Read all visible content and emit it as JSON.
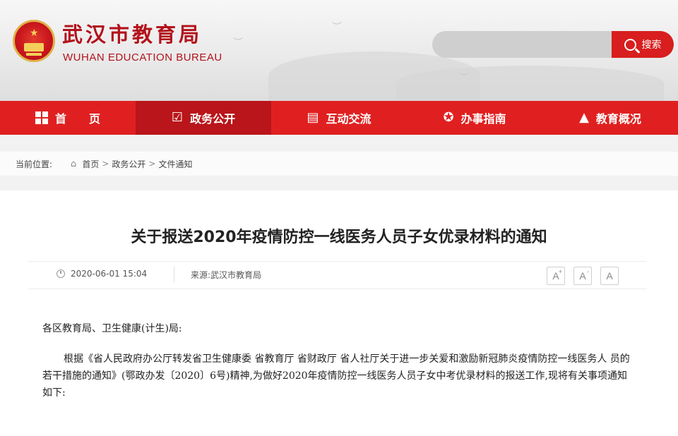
{
  "header": {
    "title": "武汉市教育局",
    "subtitle": "WUHAN EDUCATION BUREAU",
    "search": {
      "placeholder": "",
      "button_label": "搜索"
    }
  },
  "nav": {
    "items": [
      {
        "label": "首　　页",
        "icon": "home-grid-icon"
      },
      {
        "label": "政务公开",
        "icon": "calendar-check-icon"
      },
      {
        "label": "互动交流",
        "icon": "document-icon"
      },
      {
        "label": "办事指南",
        "icon": "star-badge-icon"
      },
      {
        "label": "教育概况",
        "icon": "graduation-cap-icon"
      }
    ],
    "active_index": 1
  },
  "breadcrumb": {
    "label": "当前位置:",
    "items": [
      "首页",
      "政务公开",
      "文件通知"
    ],
    "separator": ">"
  },
  "article": {
    "title": "关于报送2020年疫情防控一线医务人员子女优录材料的通知",
    "datetime": "2020-06-01 15:04",
    "source": "来源:武汉市教育局",
    "font_buttons": [
      "A+",
      "A-",
      "A"
    ],
    "salutation": "各区教育局、卫生健康(计生)局:",
    "paragraph": "根据《省人民政府办公厅转发省卫生健康委 省教育厅 省财政厅 省人社厅关于进一步关爱和激励新冠肺炎疫情防控一线医务人 员的若干措施的通知》(鄂政办发〔2020〕6号)精神,为做好2020年疫情防控一线医务人员子女中考优录材料的报送工作,现将有关事项通知如下:"
  },
  "colors": {
    "brand_red": "#e02020",
    "active_red": "#b9151a",
    "title_red": "#b3121b"
  }
}
